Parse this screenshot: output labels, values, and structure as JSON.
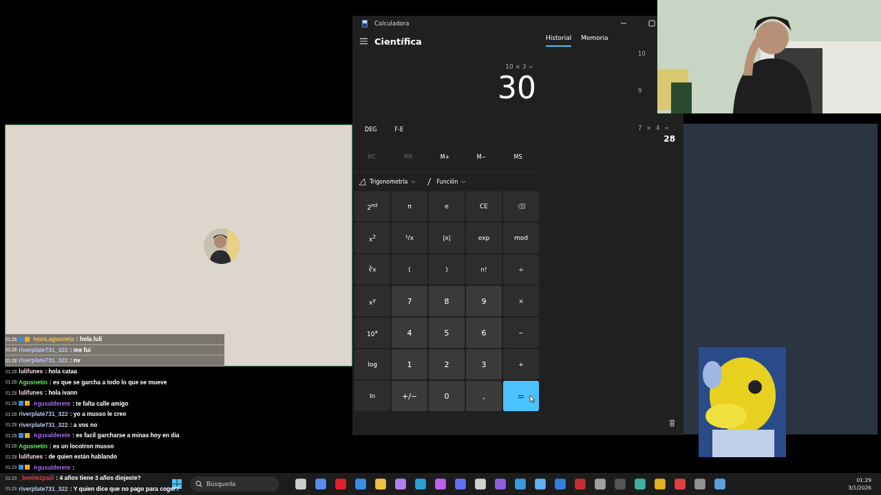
{
  "chat": [
    {
      "time": "01:28",
      "user": "IvanLagusneta",
      "message": ": hola luli",
      "color": "#e8c060",
      "highlighted": true,
      "badges": true
    },
    {
      "time": "01:28",
      "user": "riverplate731_322",
      "message": ": me fui",
      "color": "#b8c4f0",
      "highlighted": true,
      "badges": false
    },
    {
      "time": "01:28",
      "user": "riverplate731_322",
      "message": ": nv",
      "color": "#b8c4f0",
      "highlighted": true,
      "badges": false
    },
    {
      "time": "01:28",
      "user": "lulifunes",
      "message": ": hola cataa",
      "color": "#f4d8e4",
      "highlighted": false,
      "badges": false
    },
    {
      "time": "01:28",
      "user": "Agusnetin",
      "message": ": es que se garcha a todo lo que se mueve",
      "color": "#5ef05e",
      "highlighted": false,
      "badges": false
    },
    {
      "time": "01:28",
      "user": "lulifunes",
      "message": ": hola ivann",
      "color": "#f4d8e4",
      "highlighted": false,
      "badges": false
    },
    {
      "time": "01:28",
      "user": "Agusalderete",
      "message": ": te falta calle amigo",
      "color": "#a66af0",
      "highlighted": false,
      "badges": true
    },
    {
      "time": "01:28",
      "user": "riverplate731_322",
      "message": ": yo a musso le creo",
      "color": "#b8c4f0",
      "highlighted": false,
      "badges": false
    },
    {
      "time": "01:28",
      "user": "riverplate731_322",
      "message": ": a vos no",
      "color": "#b8c4f0",
      "highlighted": false,
      "badges": false
    },
    {
      "time": "01:28",
      "user": "Agusalderete",
      "message": ": es facil garcharse a minas hoy en dia",
      "color": "#a66af0",
      "highlighted": false,
      "badges": true
    },
    {
      "time": "01:28",
      "user": "Agusnetin",
      "message": ": es un locotron musso",
      "color": "#5ef05e",
      "highlighted": false,
      "badges": false
    },
    {
      "time": "01:28",
      "user": "lulifunes",
      "message": ": de quien están hablando",
      "color": "#f4d8e4",
      "highlighted": false,
      "badges": false
    },
    {
      "time": "01:29",
      "user": "Agusalderete",
      "message": ":",
      "color": "#a66af0",
      "highlighted": false,
      "badges": true
    },
    {
      "time": "01:29",
      "user": "_benitezpaiil",
      "message": ": 4 años tiene 3 años diojeste?",
      "color": "#e83a4a",
      "highlighted": false,
      "badges": false
    },
    {
      "time": "01:29",
      "user": "riverplate731_322",
      "message": ": Y quien dice que no pago para coger?",
      "color": "#b8c4f0",
      "highlighted": false,
      "badges": false
    }
  ],
  "calculator": {
    "title": "Calculadora",
    "mode": "Científica",
    "tabs": [
      {
        "label": "Historial",
        "selected": true
      },
      {
        "label": "Memoria",
        "selected": false
      }
    ],
    "expression": "10 × 3 =",
    "value": "30",
    "angle": "DEG",
    "notation": "F-E",
    "memory": [
      {
        "label": "MC",
        "disabled": true
      },
      {
        "label": "MR",
        "disabled": true
      },
      {
        "label": "M+",
        "disabled": false
      },
      {
        "label": "M−",
        "disabled": false
      },
      {
        "label": "MS",
        "disabled": false
      }
    ],
    "dropdowns": [
      {
        "label": "Trigonometría",
        "kind": "trig"
      },
      {
        "label": "Función",
        "kind": "function"
      }
    ],
    "keys": [
      {
        "label": "2$^{nd}$",
        "kind": "fn"
      },
      {
        "label": "π",
        "kind": "fn"
      },
      {
        "label": "e",
        "kind": "fn"
      },
      {
        "label": "CE",
        "kind": "fn"
      },
      {
        "kind": "backspace"
      },
      {
        "label": "x$^{2}$",
        "kind": "fn"
      },
      {
        "label": "¹/x",
        "kind": "fn"
      },
      {
        "label": "|x|",
        "kind": "fn"
      },
      {
        "label": "exp",
        "kind": "fn"
      },
      {
        "label": "mod",
        "kind": "fn"
      },
      {
        "label": "∛x",
        "kind": "fn"
      },
      {
        "label": "(",
        "kind": "fn"
      },
      {
        "label": ")",
        "kind": "fn"
      },
      {
        "label": "n!",
        "kind": "fn"
      },
      {
        "label": "÷",
        "kind": "fn"
      },
      {
        "label": "x$^{y}$",
        "kind": "fn"
      },
      {
        "label": "7",
        "kind": "digit"
      },
      {
        "label": "8",
        "kind": "digit"
      },
      {
        "label": "9",
        "kind": "digit"
      },
      {
        "label": "×",
        "kind": "fn"
      },
      {
        "label": "10$^{x}$",
        "kind": "fn"
      },
      {
        "label": "4",
        "kind": "digit"
      },
      {
        "label": "5",
        "kind": "digit"
      },
      {
        "label": "6",
        "kind": "digit"
      },
      {
        "label": "−",
        "kind": "fn"
      },
      {
        "label": "log",
        "kind": "fn"
      },
      {
        "label": "1",
        "kind": "digit"
      },
      {
        "label": "2",
        "kind": "digit"
      },
      {
        "label": "3",
        "kind": "digit"
      },
      {
        "label": "+",
        "kind": "fn"
      },
      {
        "label": "ln",
        "kind": "fn"
      },
      {
        "label": "+/−",
        "kind": "digit"
      },
      {
        "label": "0",
        "kind": "digit"
      },
      {
        "label": ",",
        "kind": "digit"
      },
      {
        "label": "=",
        "kind": "equals"
      }
    ],
    "history": [
      {
        "expression": "10"
      },
      {
        "expression": "9"
      },
      {
        "expression": "7 × 4 =",
        "result": "28"
      }
    ]
  },
  "taskbar": {
    "search": {
      "placeholder": "Búsqueda"
    },
    "time": "01:29",
    "date": "3/1/2026"
  }
}
